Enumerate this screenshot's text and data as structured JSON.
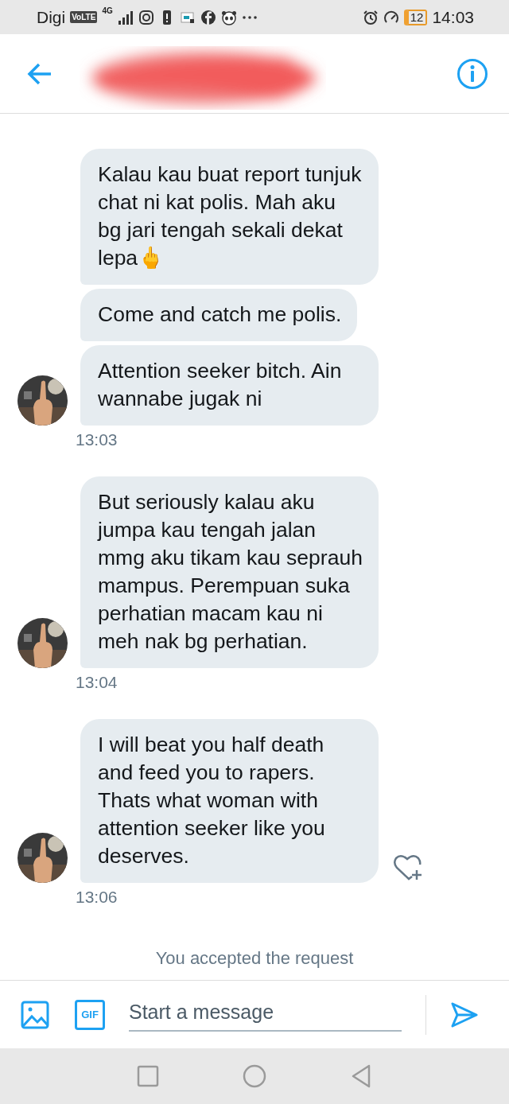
{
  "status_bar": {
    "carrier": "Digi",
    "volte_badge": "VoLTE",
    "network": "4G",
    "battery": "12",
    "time": "14:03"
  },
  "conversation": [
    {
      "messages": [
        "Kalau kau buat report tunjuk chat ni kat polis. Mah aku bg jari tengah sekali dekat lepa🖕",
        "Come and catch me polis.",
        "Attention seeker bitch. Ain wannabe jugak ni"
      ],
      "time": "13:03",
      "like_button": false
    },
    {
      "messages": [
        "But seriously kalau aku jumpa kau tengah jalan mmg aku tikam kau seprauh mampus. Perempuan suka perhatian macam kau ni meh nak bg perhatian."
      ],
      "time": "13:04",
      "like_button": false
    },
    {
      "messages": [
        "I will beat you half death and feed you to rapers. Thats what woman with attention seeker like you deserves."
      ],
      "time": "13:06",
      "like_button": true
    }
  ],
  "notice": "You accepted the request",
  "composer": {
    "gif_label": "GIF",
    "placeholder": "Start a message"
  }
}
